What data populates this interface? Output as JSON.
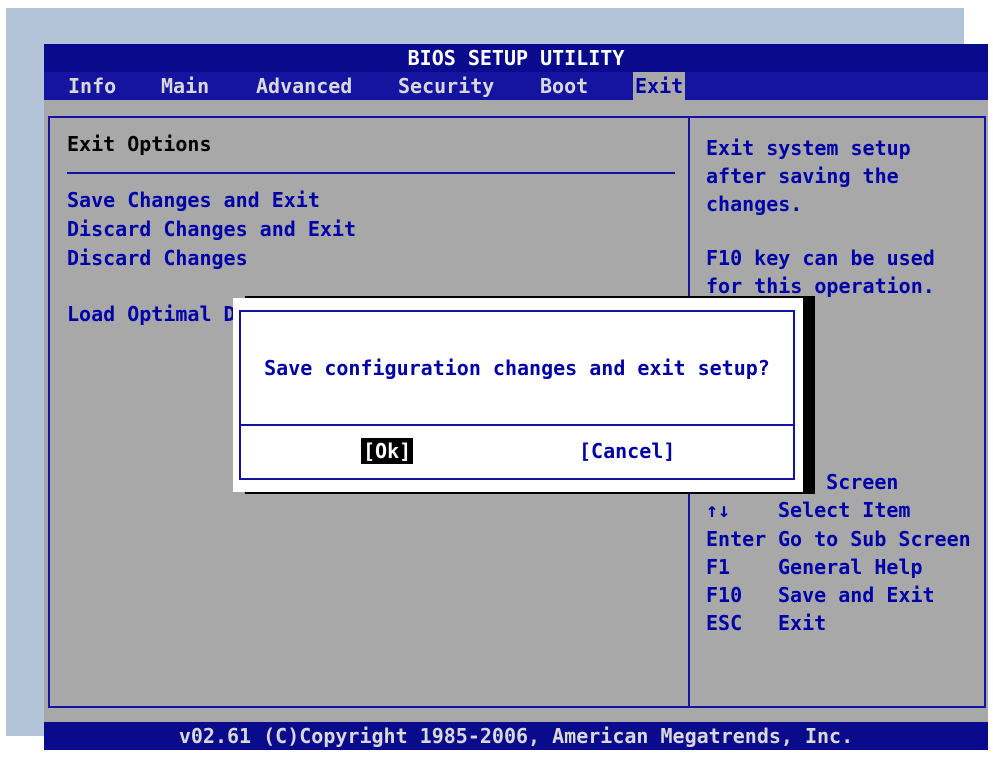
{
  "title": "BIOS SETUP UTILITY",
  "menu": [
    {
      "label": "Info",
      "active": false
    },
    {
      "label": "Main",
      "active": false
    },
    {
      "label": "Advanced",
      "active": false
    },
    {
      "label": "Security",
      "active": false
    },
    {
      "label": "Boot",
      "active": false
    },
    {
      "label": "Exit",
      "active": true
    }
  ],
  "main": {
    "section_title": "Exit Options",
    "options": [
      "Save Changes and Exit",
      "Discard Changes and Exit",
      "Discard Changes",
      "Load Optimal D"
    ]
  },
  "help": {
    "lines": [
      "Exit system setup",
      "after saving the",
      "changes.",
      "F10 key can be used",
      "for this operation."
    ],
    "keys": [
      {
        "key": "",
        "desc": "ect Screen"
      },
      {
        "key": "↑↓",
        "desc": "Select Item"
      },
      {
        "key": "Enter",
        "desc": "Go to Sub Screen"
      },
      {
        "key": "F1",
        "desc": "General Help"
      },
      {
        "key": "F10",
        "desc": "Save and Exit"
      },
      {
        "key": "ESC",
        "desc": "Exit"
      }
    ]
  },
  "dialog": {
    "message": "Save configuration changes and exit setup?",
    "ok_label": "[Ok]",
    "cancel_label": "[Cancel]"
  },
  "footer": "v02.61 (C)Copyright 1985-2006, American Megatrends, Inc.",
  "colors": {
    "title_bg": "#0a0a8c",
    "panel_bg": "#a8a8a8",
    "text_blue": "#0000a8",
    "dialog_bg": "#ffffff"
  }
}
